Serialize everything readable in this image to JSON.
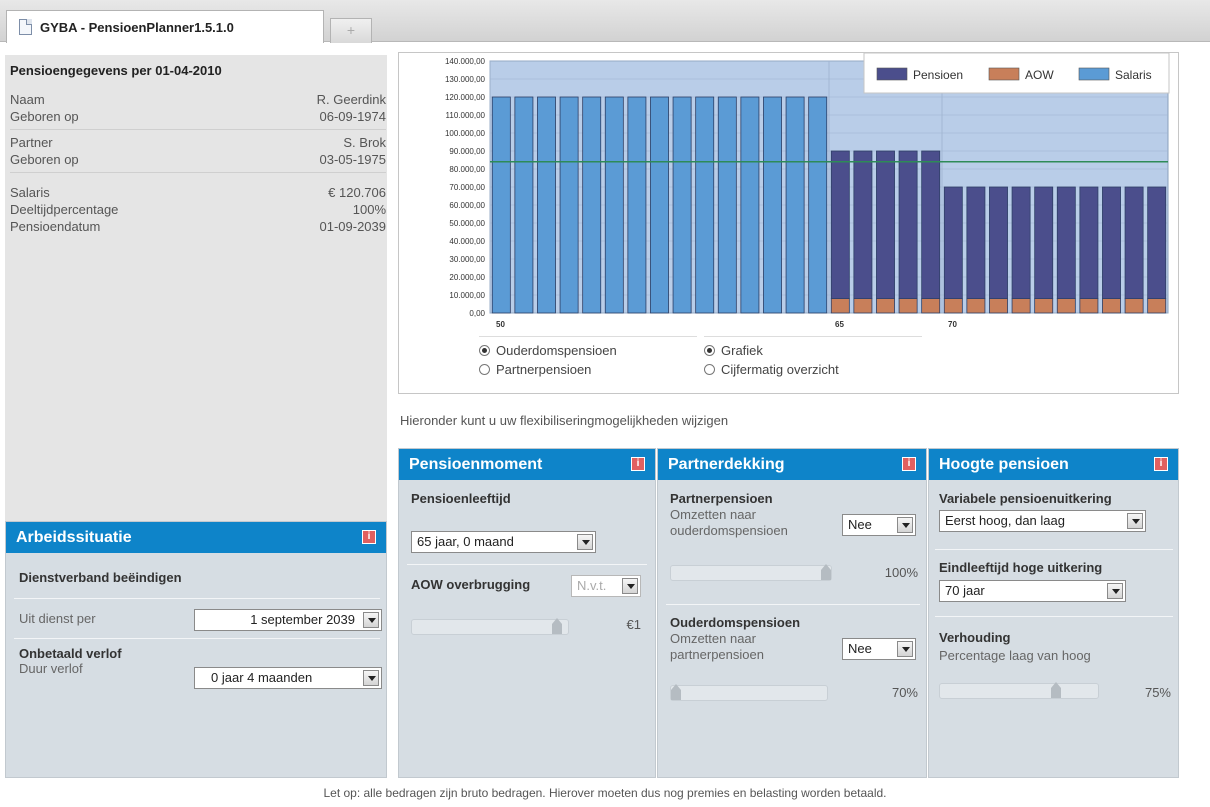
{
  "tab": {
    "title": "GYBA - PensioenPlanner1.5.1.0",
    "new_tab": "+"
  },
  "info": {
    "title": "Pensioengegevens per 01-04-2010",
    "rows": [
      {
        "label": "Naam",
        "value": "R. Geerdink"
      },
      {
        "label": "Geboren op",
        "value": "06-09-1974"
      },
      {
        "label": "Partner",
        "value": "S. Brok"
      },
      {
        "label": "Geboren op",
        "value": "03-05-1975"
      },
      {
        "label": "Salaris",
        "value": "€ 120.706"
      },
      {
        "label": "Deeltijdpercentage",
        "value": "100%"
      },
      {
        "label": "Pensioendatum",
        "value": "01-09-2039"
      }
    ]
  },
  "arbeid": {
    "title": "Arbeidssituatie",
    "sub1": "Dienstverband beëindigen",
    "uit_label": "Uit dienst per",
    "uit_value": "1 september 2039",
    "sub2": "Onbetaald verlof",
    "duur_label": "Duur verlof",
    "duur_value": "0 jaar 4 maanden"
  },
  "chart_data": {
    "type": "bar",
    "stacked": true,
    "y_ticks": [
      "0,00",
      "10.000,00",
      "20.000,00",
      "30.000,00",
      "40.000,00",
      "50.000,00",
      "60.000,00",
      "70.000,00",
      "80.000,00",
      "90.000,00",
      "100.000,00",
      "110.000,00",
      "120.000,00",
      "130.000,00",
      "140.000,00"
    ],
    "ylim": [
      0,
      140000
    ],
    "x_labels": [
      {
        "index": 0,
        "label": "50"
      },
      {
        "index": 15,
        "label": "65"
      },
      {
        "index": 20,
        "label": "70"
      }
    ],
    "categories": [
      "50",
      "51",
      "52",
      "53",
      "54",
      "55",
      "56",
      "57",
      "58",
      "59",
      "60",
      "61",
      "62",
      "63",
      "64",
      "65",
      "66",
      "67",
      "68",
      "69",
      "70",
      "71",
      "72",
      "73",
      "74",
      "75",
      "76",
      "77",
      "78",
      "79"
    ],
    "reference_line": 84000,
    "series": [
      {
        "name": "Salaris",
        "color": "#5b9bd5",
        "values": [
          120000,
          120000,
          120000,
          120000,
          120000,
          120000,
          120000,
          120000,
          120000,
          120000,
          120000,
          120000,
          120000,
          120000,
          120000,
          0,
          0,
          0,
          0,
          0,
          0,
          0,
          0,
          0,
          0,
          0,
          0,
          0,
          0,
          0
        ]
      },
      {
        "name": "AOW",
        "color": "#c87f5a",
        "values": [
          0,
          0,
          0,
          0,
          0,
          0,
          0,
          0,
          0,
          0,
          0,
          0,
          0,
          0,
          0,
          8000,
          8000,
          8000,
          8000,
          8000,
          8000,
          8000,
          8000,
          8000,
          8000,
          8000,
          8000,
          8000,
          8000,
          8000
        ]
      },
      {
        "name": "Pensioen",
        "color": "#4b4e8c",
        "values": [
          0,
          0,
          0,
          0,
          0,
          0,
          0,
          0,
          0,
          0,
          0,
          0,
          0,
          0,
          0,
          82000,
          82000,
          82000,
          82000,
          82000,
          62000,
          62000,
          62000,
          62000,
          62000,
          62000,
          62000,
          62000,
          62000,
          62000
        ]
      }
    ],
    "legend_order": [
      "Pensioen",
      "AOW",
      "Salaris"
    ],
    "legend_position": "top-right",
    "grid": true
  },
  "chart_controls": {
    "radio1": "Ouderdomspensioen",
    "radio2": "Partnerpensioen",
    "radio3": "Grafiek",
    "radio4": "Cijfermatig overzicht"
  },
  "flex_note": "Hieronder kunt u uw flexibiliseringmogelijkheden wijzigen",
  "moment": {
    "title": "Pensioenmoment",
    "leeftijd_label": "Pensioenleeftijd",
    "leeftijd_value": "65 jaar, 0 maand",
    "aow_label": "AOW overbrugging",
    "aow_value": "N.v.t.",
    "aow_amount": "€1"
  },
  "partner": {
    "title": "Partnerdekking",
    "pp_label": "Partnerpensioen",
    "pp_sub1": "Omzetten naar",
    "pp_sub2": "ouderdomspensioen",
    "pp_value": "Nee",
    "pp_pct": "100%",
    "op_label": "Ouderdomspensioen",
    "op_sub1": "Omzetten naar",
    "op_sub2": "partnerpensioen",
    "op_value": "Nee",
    "op_pct": "70%"
  },
  "hoogte": {
    "title": "Hoogte pensioen",
    "var_label": "Variabele pensioenuitkering",
    "var_value": "Eerst hoog, dan laag",
    "eind_label": "Eindleeftijd hoge uitkering",
    "eind_value": "70 jaar",
    "verh_label": "Verhouding",
    "verh_sub": "Percentage laag van hoog",
    "verh_pct": "75%"
  },
  "footer": "Let op: alle bedragen zijn bruto bedragen. Hierover moeten dus nog premies en belasting worden betaald.",
  "sliders": {
    "aow": 0.96,
    "pp": 1.0,
    "op": 0.0,
    "verh": 0.75
  }
}
